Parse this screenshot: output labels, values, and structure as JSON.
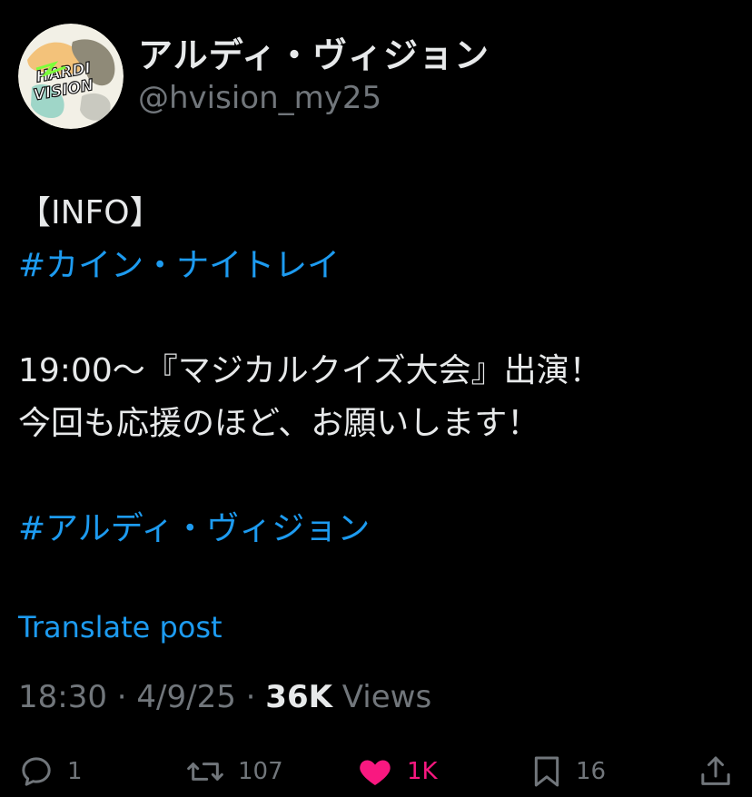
{
  "post": {
    "author": {
      "display_name": "アルディ・ヴィジョン",
      "handle": "@hvision_my25",
      "avatar_text": "HARDI VISION"
    },
    "body": {
      "line1": "【INFO】",
      "hashtag1": "#カイン・ナイトレイ",
      "line3": "19:00～『マジカルクイズ大会』出演！",
      "line4": "今回も応援のほど、お願いします！",
      "hashtag2": "#アルディ・ヴィジョン"
    },
    "translate_label": "Translate post",
    "meta": {
      "time": "18:30",
      "separator": "·",
      "date": "4/9/25",
      "views_count": "36K",
      "views_label": "Views"
    },
    "actions": {
      "reply_count": "1",
      "repost_count": "107",
      "like_count": "1K",
      "bookmark_count": "16"
    }
  },
  "colors": {
    "background": "#000000",
    "primary_text": "#e7e9ea",
    "secondary_text": "#71767b",
    "link": "#1d9bf0",
    "like": "#f91880"
  },
  "icons": [
    "reply-icon",
    "repost-icon",
    "heart-icon",
    "bookmark-icon",
    "share-icon"
  ]
}
